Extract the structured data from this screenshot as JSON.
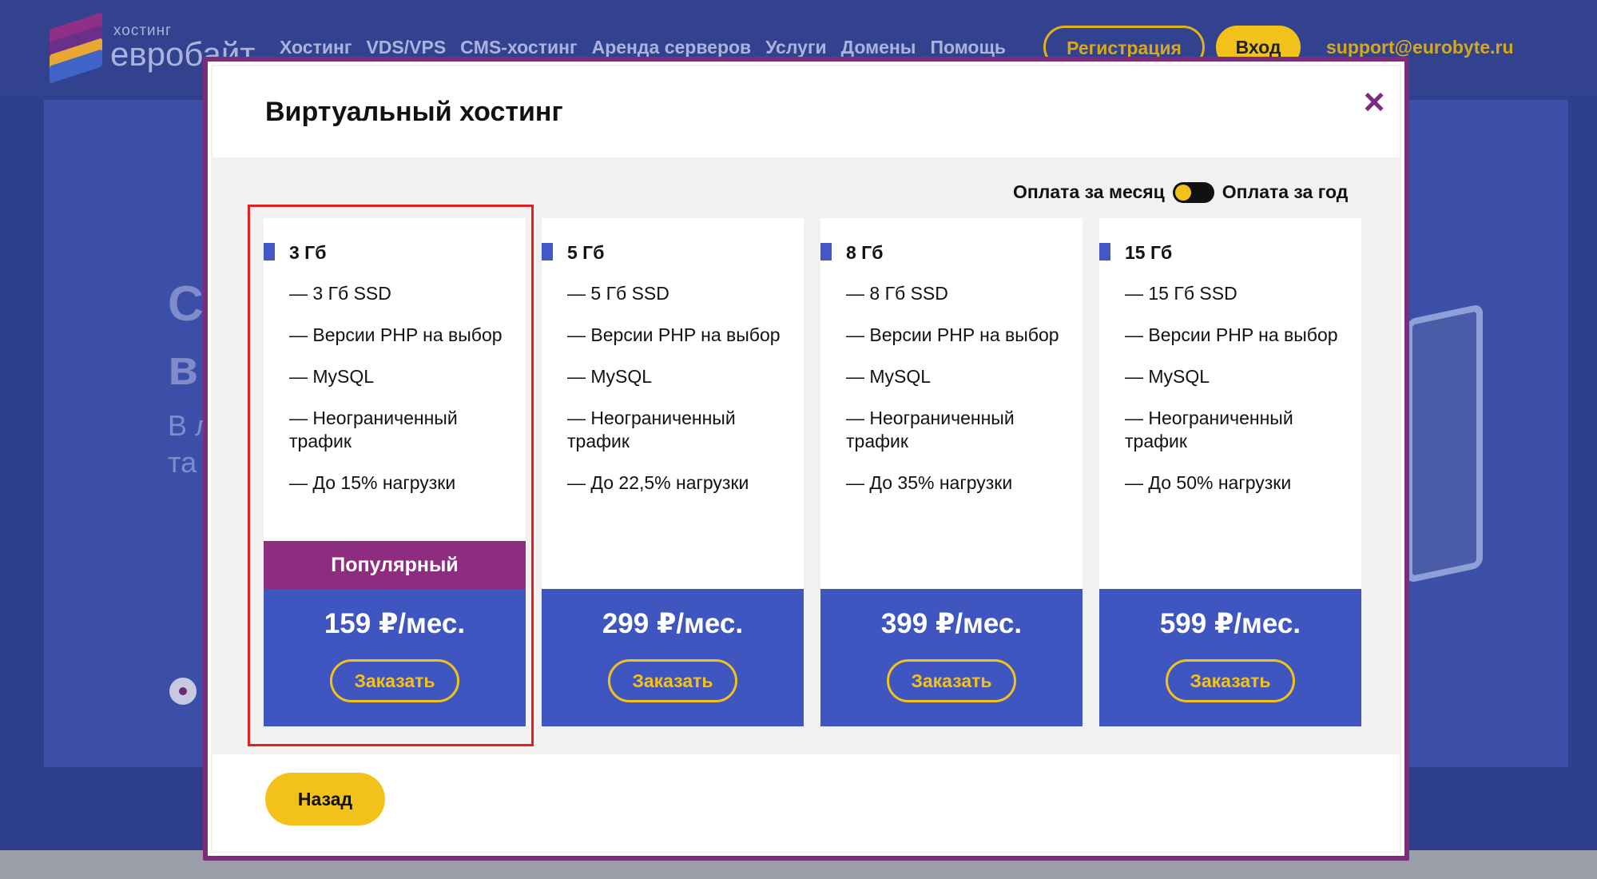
{
  "header": {
    "logo_sub": "хостинг",
    "logo_main": "евробайт",
    "nav": [
      "Хостинг",
      "VDS/VPS",
      "CMS-хостинг",
      "Аренда серверов",
      "Услуги",
      "Домены",
      "Помощь"
    ],
    "register_label": "Регистрация",
    "login_label": "Вход",
    "support_email": "support@eurobyte.ru"
  },
  "hero": {
    "line1": "С",
    "line2": "в",
    "text1": "В л",
    "text2": "та"
  },
  "modal": {
    "title": "Виртуальный хостинг",
    "close": "×",
    "billing_month": "Оплата за месяц",
    "billing_year": "Оплата за год",
    "back_label": "Назад",
    "order_label": "Заказать",
    "popular_label": "Популярный",
    "plans": [
      {
        "name": "3 Гб",
        "features": [
          "— 3 Гб SSD",
          "— Версии PHP на выбор",
          "— MySQL",
          "— Неограниченный трафик",
          "— До 15% нагрузки"
        ],
        "price": "159 ₽/мес.",
        "popular": true
      },
      {
        "name": "5 Гб",
        "features": [
          "— 5 Гб SSD",
          "— Версии PHP на выбор",
          "— MySQL",
          "— Неограниченный трафик",
          "— До 22,5% нагрузки"
        ],
        "price": "299 ₽/мес.",
        "popular": false
      },
      {
        "name": "8 Гб",
        "features": [
          "— 8 Гб SSD",
          "— Версии PHP на выбор",
          "— MySQL",
          "— Неограниченный трафик",
          "— До 35% нагрузки"
        ],
        "price": "399 ₽/мес.",
        "popular": false
      },
      {
        "name": "15 Гб",
        "features": [
          "— 15 Гб SSD",
          "— Версии PHP на выбор",
          "— MySQL",
          "— Неограниченный трафик",
          "— До 50% нагрузки"
        ],
        "price": "599 ₽/мес.",
        "popular": false
      }
    ]
  },
  "colors": {
    "accent_purple": "#7b2d7b",
    "popular_bg": "#8e2c7f",
    "price_bg": "#3f56c1",
    "yellow": "#f3c21a",
    "highlight": "#e02020"
  }
}
